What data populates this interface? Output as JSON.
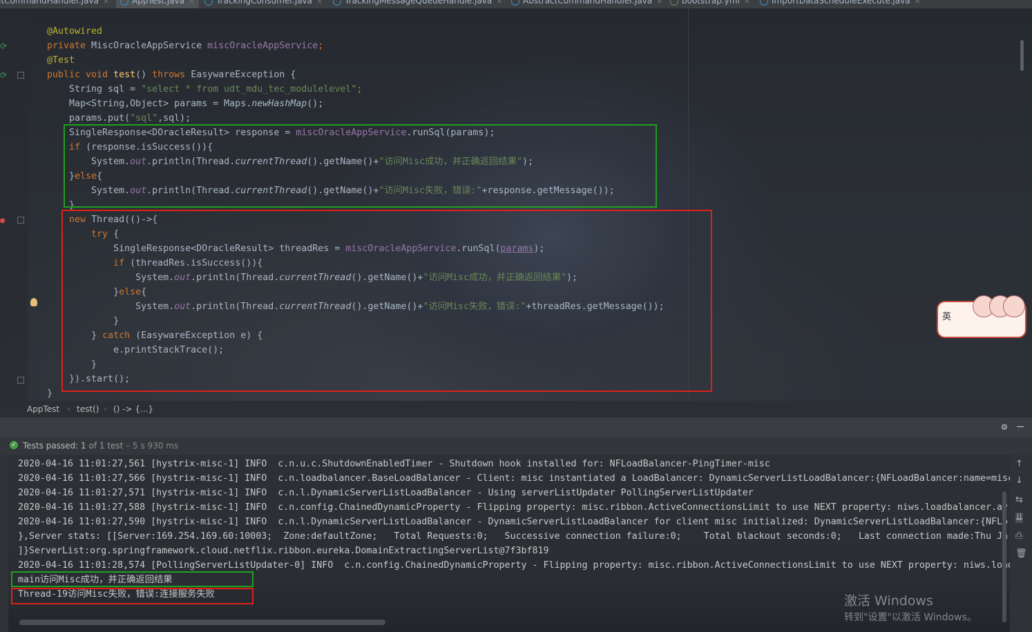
{
  "tabs": [
    {
      "label": "itCommandHandler.java"
    },
    {
      "label": "AppTest.java"
    },
    {
      "label": "TrackingConsumer.java"
    },
    {
      "label": "TrackingMessageQueueHandle.java"
    },
    {
      "label": "AbstractCommandHandler.java"
    },
    {
      "label": "bootstrap.yml"
    },
    {
      "label": "ImportDataScheduleExecute.java"
    }
  ],
  "tab_close": "×",
  "code": {
    "l1": "@Autowired",
    "l2a": "private ",
    "l2b": "MiscOracleAppService ",
    "l2c": "miscOracleAppService",
    "l2d": ";",
    "l3": "@Test",
    "l4a": "public void ",
    "l4b": "test",
    "l4c": "() ",
    "l4d": "throws ",
    "l4e": "EasywareException {",
    "l5a": "    String sql = ",
    "l5b": "\"select * from udt_mdu_tec_modulelevel\"",
    "l5c": ";",
    "l6a": "    Map<String,Object> params = Maps.",
    "l6b": "newHashMap",
    "l6c": "();",
    "l7a": "    params.put(",
    "l7b": "\"sql\"",
    "l7c": ",sql);",
    "l8a": "    SingleResponse<DOracleResult> response = ",
    "l8b": "miscOracleAppService",
    "l8c": ".runSql(params);",
    "l9a": "    ",
    "l9b": "if ",
    "l9c": "(response.isSuccess()){",
    "l10a": "        System.",
    "l10b": "out",
    "l10c": ".println(Thread.",
    "l10d": "currentThread",
    "l10e": "().getName()+",
    "l10f": "\"访问Misc成功，并正确返回结果\"",
    "l10g": ");",
    "l11a": "    }",
    "l11b": "else",
    "l11c": "{",
    "l12a": "        System.",
    "l12b": "out",
    "l12c": ".println(Thread.",
    "l12d": "currentThread",
    "l12e": "().getName()+",
    "l12f": "\"访问Misc失败，错误:\"",
    "l12g": "+response.getMessage());",
    "l13": "    }",
    "l14a": "    ",
    "l14b": "new ",
    "l14c": "Thread(()->{",
    "l15a": "        ",
    "l15b": "try ",
    "l15c": "{",
    "l16a": "            SingleResponse<DOracleResult> threadRes = ",
    "l16b": "miscOracleAppService",
    "l16c": ".runSql(",
    "l16d": "params",
    "l16e": ");",
    "l17a": "            ",
    "l17b": "if ",
    "l17c": "(threadRes.isSuccess()){",
    "l18a": "                System.",
    "l18b": "out",
    "l18c": ".println(Thread.",
    "l18d": "currentThread",
    "l18e": "().getName()+",
    "l18f": "\"访问Misc成功，并正确返回结果\"",
    "l18g": ");",
    "l19a": "            }",
    "l19b": "else",
    "l19c": "{",
    "l20a": "                System.",
    "l20b": "out",
    "l20c": ".println(Thread.",
    "l20d": "currentThread",
    "l20e": "().getName()+",
    "l20f": "\"访问Misc失败，错误:\"",
    "l20g": "+threadRes.getMessage());",
    "l21": "            }",
    "l22a": "        } ",
    "l22b": "catch ",
    "l22c": "(EasywareException e) {",
    "l23": "            e.printStackTrace();",
    "l24": "        }",
    "l25": "    }).start();",
    "l26": "}"
  },
  "breadcrumb": {
    "class": "AppTest",
    "method": "test()",
    "lambda": "() -> {...}",
    "sep": "›"
  },
  "run": {
    "status_prefix": "Tests passed: ",
    "status_count": "1",
    "status_mid": " of 1 test",
    "status_time": " – 5 s 930 ms",
    "settings_icon": "⚙",
    "minimize_icon": "—"
  },
  "console": [
    "2020-04-16 11:01:27,561 [hystrix-misc-1] INFO  c.n.u.c.ShutdownEnabledTimer - Shutdown hook installed for: NFLoadBalancer-PingTimer-misc",
    "2020-04-16 11:01:27,566 [hystrix-misc-1] INFO  c.n.loadbalancer.BaseLoadBalancer - Client: misc instantiated a LoadBalancer: DynamicServerListLoadBalancer:{NFLoadBalancer:name=misc",
    "2020-04-16 11:01:27,571 [hystrix-misc-1] INFO  c.n.l.DynamicServerListLoadBalancer - Using serverListUpdater PollingServerListUpdater",
    "2020-04-16 11:01:27,588 [hystrix-misc-1] INFO  c.n.config.ChainedDynamicProperty - Flipping property: misc.ribbon.ActiveConnectionsLimit to use NEXT property: niws.loadbalancer.av",
    "2020-04-16 11:01:27,590 [hystrix-misc-1] INFO  c.n.l.DynamicServerListLoadBalancer - DynamicServerListLoadBalancer for client misc initialized: DynamicServerListLoadBalancer:{NFLo",
    "},Server stats: [[Server:169.254.169.60:10003;  Zone:defaultZone;   Total Requests:0;   Successive connection failure:0;    Total blackout seconds:0;   Last connection made:Thu Ja",
    "]}ServerList:org.springframework.cloud.netflix.ribbon.eureka.DomainExtractingServerList@7f3bf819",
    "2020-04-16 11:01:28,574 [PollingServerListUpdater-0] INFO  c.n.config.ChainedDynamicProperty - Flipping property: misc.ribbon.ActiveConnectionsLimit to use NEXT property: niws.load",
    "main访问Misc成功，并正确返回结果",
    "Thread-19访问Misc失败，错误:连接服务失败"
  ],
  "sticker": {
    "label": "英"
  },
  "watermark": {
    "title": "激活 Windows",
    "subtitle": "转到\"设置\"以激活 Windows。"
  },
  "colors": {
    "highlight_green": "#1fa01f",
    "highlight_red": "#e0211b",
    "keyword": "#cc7832",
    "string": "#6a8759",
    "field": "#9876aa"
  }
}
